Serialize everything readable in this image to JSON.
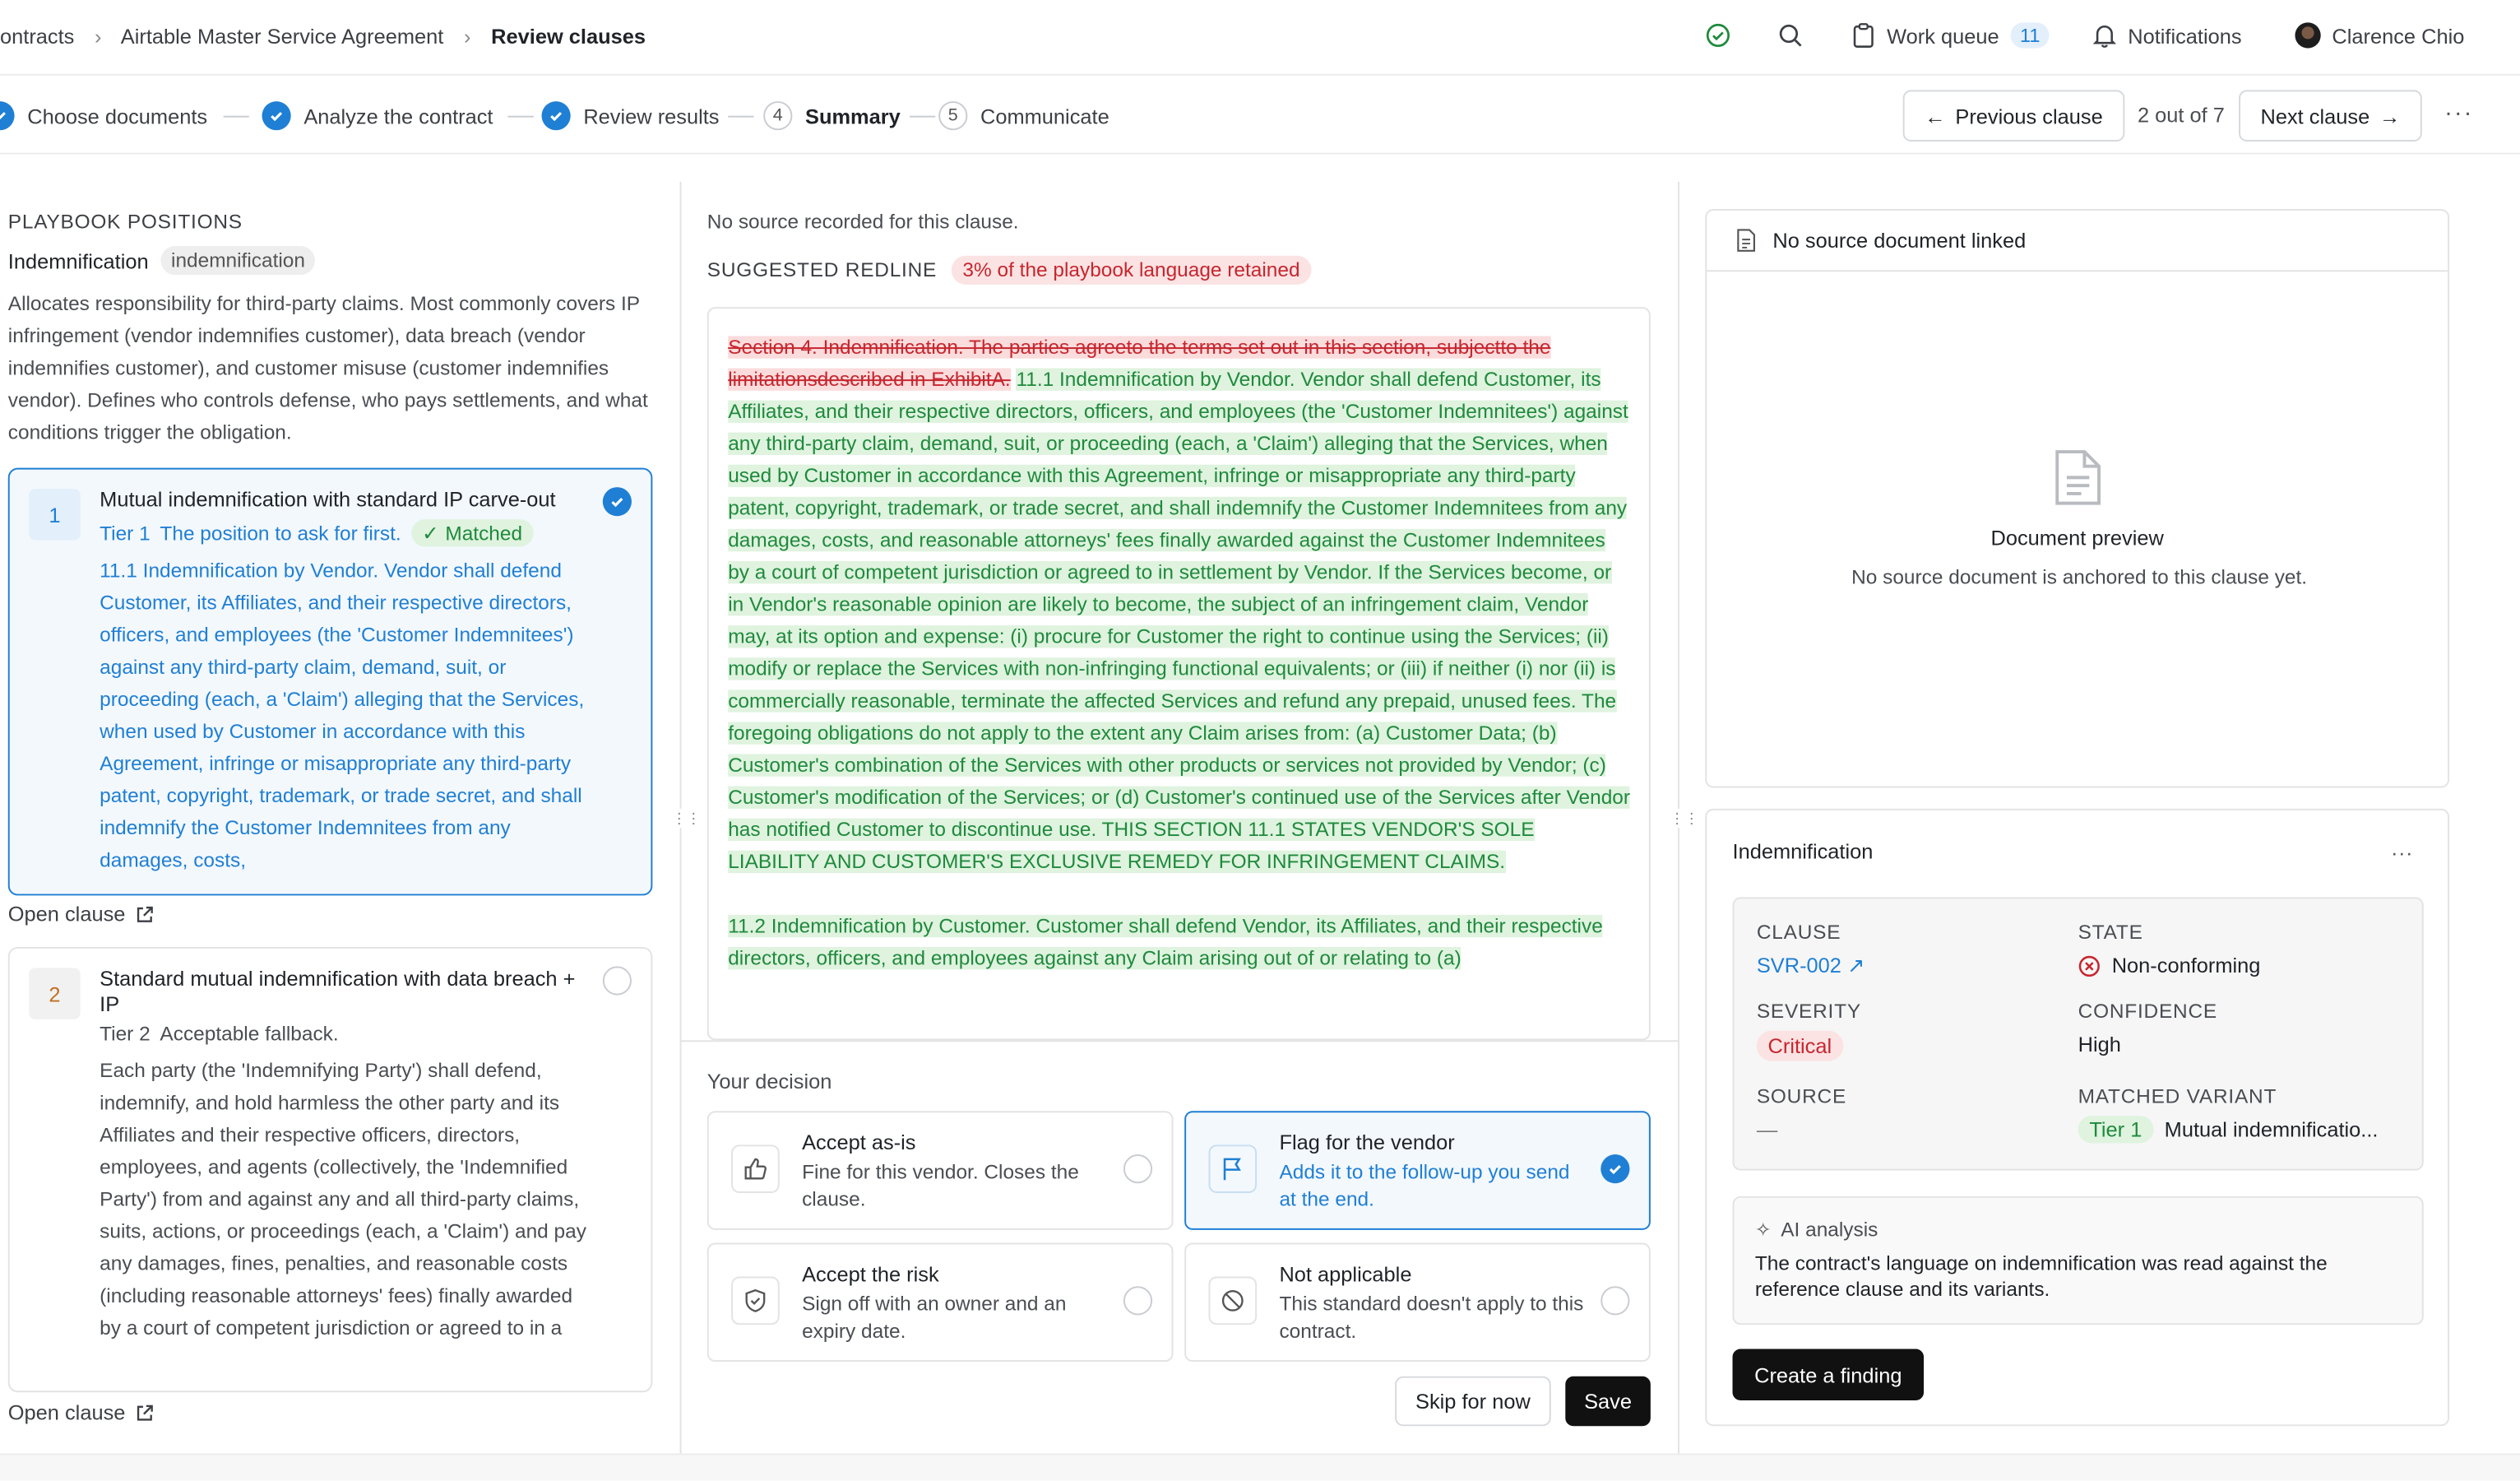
{
  "breadcrumb": {
    "item1": "ontracts",
    "item2": "Airtable Master Service Agreement",
    "current": "Review clauses"
  },
  "topbar": {
    "work_queue_label": "Work queue",
    "work_queue_count": "11",
    "notifications_label": "Notifications",
    "user_name": "Clarence Chio"
  },
  "steps": [
    {
      "label": "Choose documents",
      "state": "done"
    },
    {
      "label": "Analyze the contract",
      "state": "done"
    },
    {
      "label": "Review results",
      "state": "done"
    },
    {
      "label": "Summary",
      "number": "4",
      "state": "current"
    },
    {
      "label": "Communicate",
      "number": "5",
      "state": "upcoming"
    }
  ],
  "nav": {
    "previous": "Previous clause",
    "position": "2 out of 7",
    "next": "Next clause"
  },
  "left": {
    "section_title": "PLAYBOOK POSITIONS",
    "clause_name": "Indemnification",
    "clause_tag": "indemnification",
    "description": "Allocates responsibility for third-party claims. Most commonly covers IP infringement (vendor indemnifies customer), data breach (vendor indemnifies customer), and customer misuse (customer indemnifies vendor). Defines who controls defense, who pays settlements, and what conditions trigger the obligation.",
    "open_clause": "Open clause",
    "positions": [
      {
        "number": "1",
        "title": "Mutual indemnification with standard IP carve-out",
        "tier": "Tier 1",
        "tier_note": "The position to ask for first.",
        "status": "Matched",
        "text": "11.1 Indemnification by Vendor. Vendor shall defend Customer, its Affiliates, and their respective directors, officers, and employees (the 'Customer Indemnitees') against any third-party claim, demand, suit, or proceeding (each, a 'Claim') alleging that the Services, when used by Customer in accordance with this Agreement, infringe or misappropriate any third-party patent, copyright, trademark, or trade secret, and shall indemnify the Customer Indemnitees from any damages, costs,"
      },
      {
        "number": "2",
        "title": "Standard mutual indemnification with data breach + IP",
        "tier": "Tier 2",
        "tier_note": "Acceptable fallback.",
        "text": "Each party (the 'Indemnifying Party') shall defend, indemnify, and hold harmless the other party and its Affiliates and their respective officers, directors, employees, and agents (collectively, the 'Indemnified Party') from and against any and all third-party claims, suits, actions, or proceedings (each, a 'Claim') and pay any damages, fines, penalties, and reasonable costs (including reasonable attorneys' fees) finally awarded by a court of competent jurisdiction or agreed to in a"
      }
    ]
  },
  "middle": {
    "no_source": "No source recorded for this clause.",
    "redline_title": "SUGGESTED REDLINE",
    "retained_badge": "3% of the playbook language retained",
    "deleted_text": "Section 4. Indemnification. The parties agreeto the terms set out in this section, subjectto the limitationsdescribed in ExhibitA.",
    "inserted_p1": "11.1 Indemnification by Vendor. Vendor shall defend Customer, its Affiliates, and their respective directors, officers, and employees (the 'Customer Indemnitees') against any third-party claim, demand, suit, or proceeding (each, a 'Claim') alleging that the Services, when used by Customer in accordance with this Agreement, infringe or misappropriate any third-party patent, copyright, trademark, or trade secret, and shall indemnify the Customer Indemnitees from any damages, costs, and reasonable attorneys' fees finally awarded against the Customer Indemnitees by a court of competent jurisdiction or agreed to in settlement by Vendor. If the Services become, or in Vendor's reasonable opinion are likely to become, the subject of an infringement claim, Vendor may, at its option and expense: (i) procure for Customer the right to continue using the Services; (ii) modify or replace the Services with non-infringing functional equivalents; or (iii) if neither (i) nor (ii) is commercially reasonable, terminate the affected Services and refund any prepaid, unused fees. The foregoing obligations do not apply to the extent any Claim arises from: (a) Customer Data; (b) Customer's combination of the Services with other products or services not provided by Vendor; (c) Customer's modification of the Services; or (d) Customer's continued use of the Services after Vendor has notified Customer to discontinue use. THIS SECTION 11.1 STATES VENDOR'S SOLE LIABILITY AND CUSTOMER'S EXCLUSIVE REMEDY FOR INFRINGEMENT CLAIMS.",
    "inserted_p2": "11.2 Indemnification by Customer. Customer shall defend Vendor, its Affiliates, and their respective directors, officers, and employees against any Claim arising out of or relating to (a)",
    "decision_title": "Your decision",
    "decisions": [
      {
        "title": "Accept as-is",
        "desc": "Fine for this vendor. Closes the clause.",
        "icon": "thumbs-up-icon"
      },
      {
        "title": "Flag for the vendor",
        "desc": "Adds it to the follow-up you send at the end.",
        "icon": "flag-icon",
        "selected": true
      },
      {
        "title": "Accept the risk",
        "desc": "Sign off with an owner and an expiry date.",
        "icon": "shield-check-icon"
      },
      {
        "title": "Not applicable",
        "desc": "This standard doesn't apply to this contract.",
        "icon": "ban-icon"
      }
    ],
    "skip": "Skip for now",
    "save": "Save"
  },
  "right": {
    "no_source_doc": "No source document linked",
    "preview_title": "Document preview",
    "preview_desc": "No source document is anchored to this clause yet.",
    "detail_title": "Indemnification",
    "more": "...",
    "fields": {
      "clause_label": "CLAUSE",
      "clause_value": "SVR-002",
      "state_label": "STATE",
      "state_value": "Non-conforming",
      "severity_label": "SEVERITY",
      "severity_value": "Critical",
      "confidence_label": "CONFIDENCE",
      "confidence_value": "High",
      "source_label": "SOURCE",
      "source_value": "—",
      "variant_label": "MATCHED VARIANT",
      "variant_tier": "Tier 1",
      "variant_value": "Mutual indemnificatio..."
    },
    "ai_title": "AI analysis",
    "ai_text": "The contract's language on indemnification was read against the reference clause and its variants.",
    "create_finding": "Create a finding"
  },
  "colors": {
    "accent": "#1f7fd4",
    "critical": "#c7262f",
    "match": "#1f8a3c"
  }
}
